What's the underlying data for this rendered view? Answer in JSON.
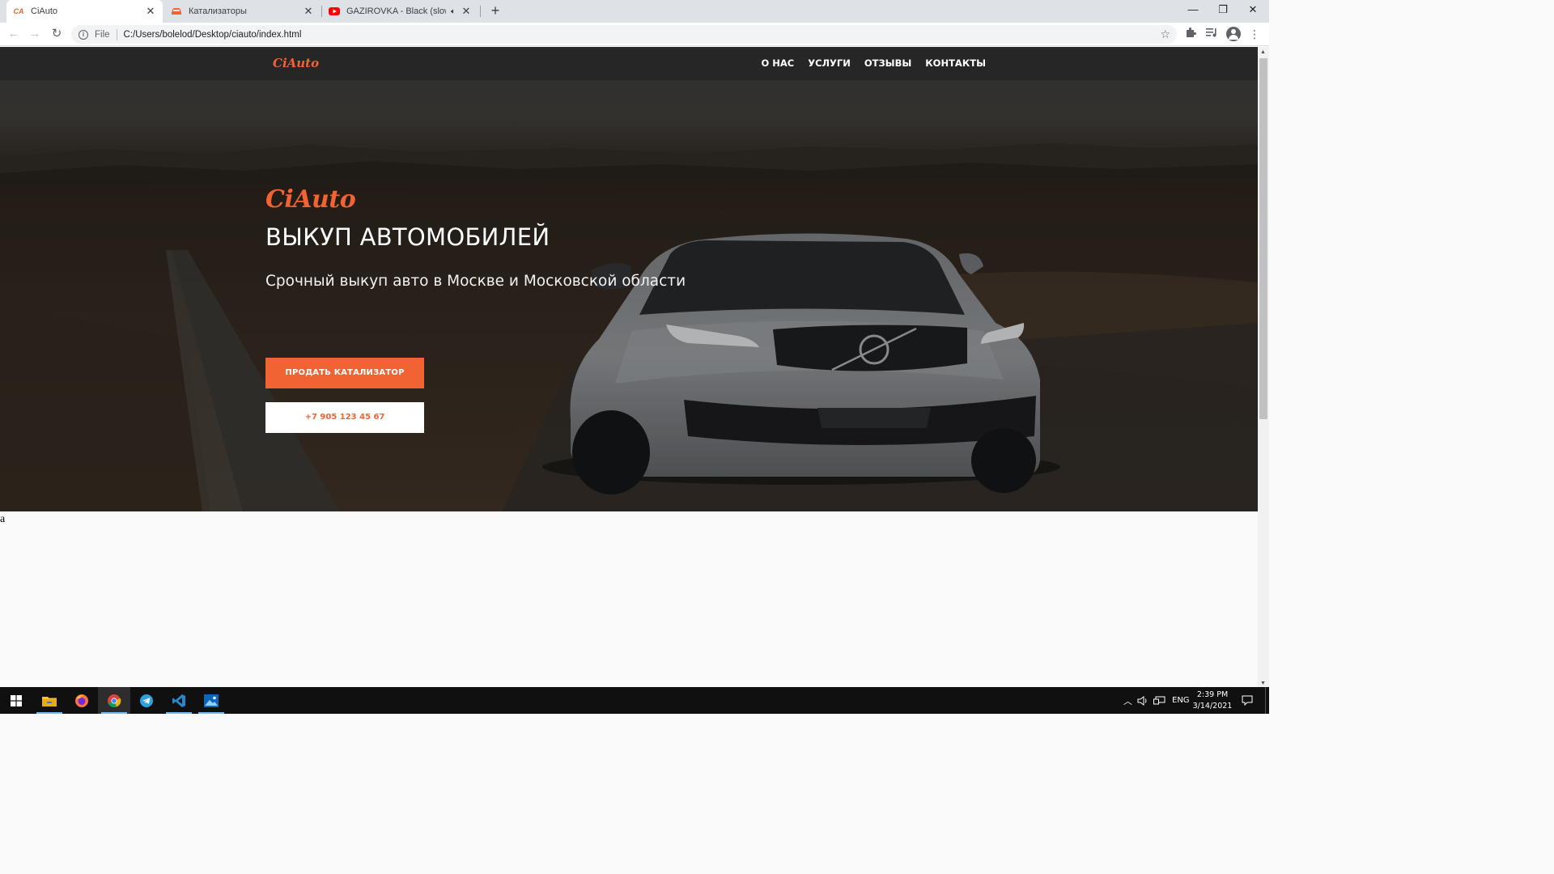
{
  "browser": {
    "tabs": [
      {
        "title": "CiAuto",
        "favicon": "CA",
        "active": true
      },
      {
        "title": "Катализаторы",
        "favicon": "car-icon",
        "active": false
      },
      {
        "title": "GAZIROVKA - Black (slowed",
        "favicon": "youtube-icon",
        "active": false,
        "audio": true
      }
    ],
    "new_tab": "+",
    "address": {
      "scheme_label": "File",
      "url": "C:/Users/bolelod/Desktop/ciauto/index.html"
    }
  },
  "site": {
    "logo": "CiAuto",
    "nav": [
      "О НАС",
      "УСЛУГИ",
      "ОТЗЫВЫ",
      "КОНТАКТЫ"
    ],
    "hero": {
      "brand": "CiAuto",
      "title": "ВЫКУП АВТОМОБИЛЕЙ",
      "subtitle": "Срочный выкуп авто в Москве и Московской области",
      "cta_primary": "ПРОДАТЬ КАТАЛИЗАТОР",
      "cta_phone": "+7 905 123 45 67",
      "car_badge": "VOLVO"
    },
    "below_hero_text": "a"
  },
  "colors": {
    "accent": "#f26334",
    "header_bg": "#262626",
    "taskbar_bg": "#101010"
  },
  "taskbar": {
    "apps": [
      "windows-start-icon",
      "file-explorer-icon",
      "firefox-icon",
      "chrome-icon",
      "telegram-icon",
      "vscode-icon",
      "photos-icon"
    ],
    "tray": {
      "language": "ENG"
    },
    "clock": {
      "time": "2:39 PM",
      "date": "3/14/2021"
    }
  }
}
